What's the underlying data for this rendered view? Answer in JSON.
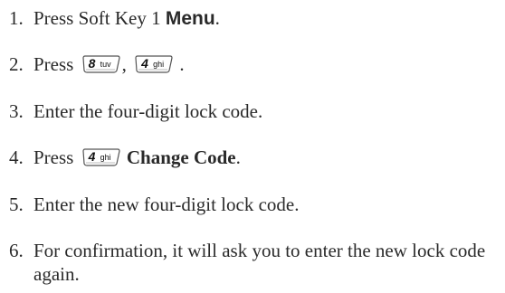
{
  "steps": [
    {
      "num": "1.",
      "pre": "Press Soft Key 1 ",
      "bold": "Menu",
      "post": "."
    },
    {
      "num": "2.",
      "pre": "Press ",
      "key1": {
        "digit": "8",
        "letters": "tuv"
      },
      "sep": ", ",
      "key2": {
        "digit": "4",
        "letters": "ghi"
      },
      "post": " ."
    },
    {
      "num": "3.",
      "text": "Enter the four-digit lock code."
    },
    {
      "num": "4.",
      "pre": "Press ",
      "key": {
        "digit": "4",
        "letters": "ghi"
      },
      "bold": "Change Code",
      "post": "."
    },
    {
      "num": "5.",
      "text": "Enter the new four-digit lock code."
    },
    {
      "num": "6.",
      "text": "For confirmation, it will ask you to enter the new lock code again."
    }
  ]
}
